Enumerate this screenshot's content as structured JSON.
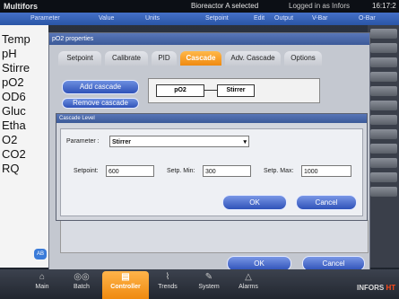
{
  "topbar": {
    "app": "Multifors",
    "reactor": "Bioreactor A selected",
    "login": "Logged in as Infors",
    "time": "16:17:2"
  },
  "columns": [
    "Parameter",
    "Value",
    "Units",
    "Setpoint",
    "Edit",
    "Output",
    "V-Bar",
    "O-Bar"
  ],
  "left_params": [
    "Temp",
    "pH",
    "Stirre",
    "pO2",
    "OD6",
    "Gluc",
    "Etha",
    "O2",
    "CO2",
    "RQ"
  ],
  "props_window": {
    "title": "pO2 properties",
    "tabs": [
      "Setpoint",
      "Calibrate",
      "PID",
      "Cascade",
      "Adv. Cascade",
      "Options"
    ],
    "active_tab": "Cascade",
    "add_cascade": "Add cascade",
    "remove_cascade": "Remove cascade",
    "diagram": {
      "source": "pO2",
      "target": "Stirrer"
    },
    "ok": "OK",
    "cancel": "Cancel"
  },
  "cascade_dialog": {
    "title": "Cascade Level",
    "parameter_label": "Parameter :",
    "parameter_value": "Stirrer",
    "setpoint_label": "Setpoint:",
    "setpoint_value": "600",
    "min_label": "Setp. Min:",
    "min_value": "300",
    "max_label": "Setp. Max:",
    "max_value": "1000",
    "ok": "OK",
    "cancel": "Cancel"
  },
  "ab_label": "AB",
  "nav": [
    {
      "label": "Main",
      "icon": "home-icon"
    },
    {
      "label": "Batch",
      "icon": "batch-icon"
    },
    {
      "label": "Controller",
      "icon": "controller-icon"
    },
    {
      "label": "Trends",
      "icon": "trends-icon"
    },
    {
      "label": "System",
      "icon": "wrench-icon"
    },
    {
      "label": "Alarms",
      "icon": "alarm-icon"
    }
  ],
  "active_nav": "Controller",
  "brand": {
    "name": "INFORS",
    "suffix": "HT"
  }
}
